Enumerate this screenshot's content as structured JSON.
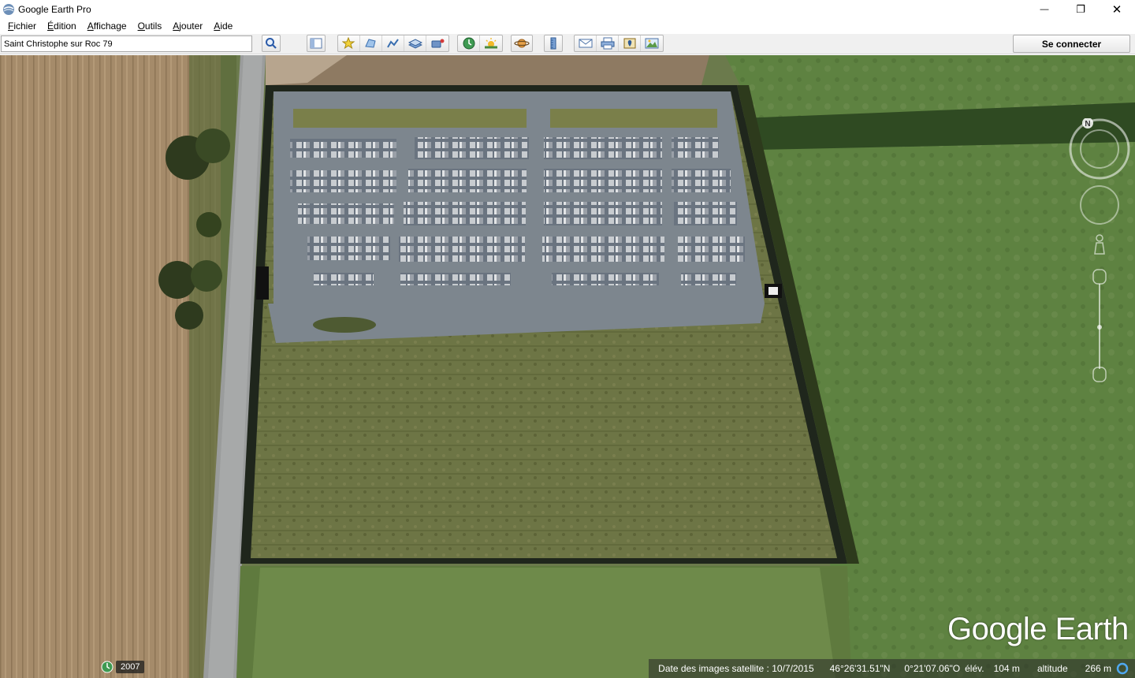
{
  "window": {
    "title": "Google Earth Pro",
    "minimize_glyph": "—",
    "restore_glyph": "❐",
    "close_glyph": "✕"
  },
  "menu": [
    {
      "label": "Fichier",
      "accel": "F",
      "rest": "ichier"
    },
    {
      "label": "Édition",
      "accel": "É",
      "rest": "dition"
    },
    {
      "label": "Affichage",
      "accel": "A",
      "rest": "ffichage",
      "pre": ""
    },
    {
      "label": "Outils",
      "accel": "O",
      "rest": "utils"
    },
    {
      "label": "Ajouter",
      "accel": "A",
      "rest": "jouter"
    },
    {
      "label": "Aide",
      "accel": "A",
      "rest": "ide"
    }
  ],
  "toolbar": {
    "search_value": "Saint Christophe sur Roc 79",
    "connect_label": "Se connecter",
    "icons": [
      "search-icon",
      "sidebar-toggle-icon",
      "placemark-icon",
      "polygon-icon",
      "path-icon",
      "image-overlay-icon",
      "record-tour-icon",
      "historical-imagery-icon",
      "sunlight-icon",
      "planets-icon",
      "ruler-icon",
      "email-icon",
      "print-icon",
      "view-in-maps-icon",
      "save-image-icon"
    ]
  },
  "map": {
    "logo_text": "Google Earth",
    "compass_north": "N"
  },
  "status": {
    "historical_year": "2007",
    "imagery_date": "Date des images satellite : 10/7/2015",
    "latitude": "46°26'31.51\"N",
    "longitude": "0°21'07.06\"O",
    "elevation_label": "élév.",
    "elevation_value": "104 m",
    "altitude_label": "altitude",
    "altitude_value": "266 m"
  }
}
